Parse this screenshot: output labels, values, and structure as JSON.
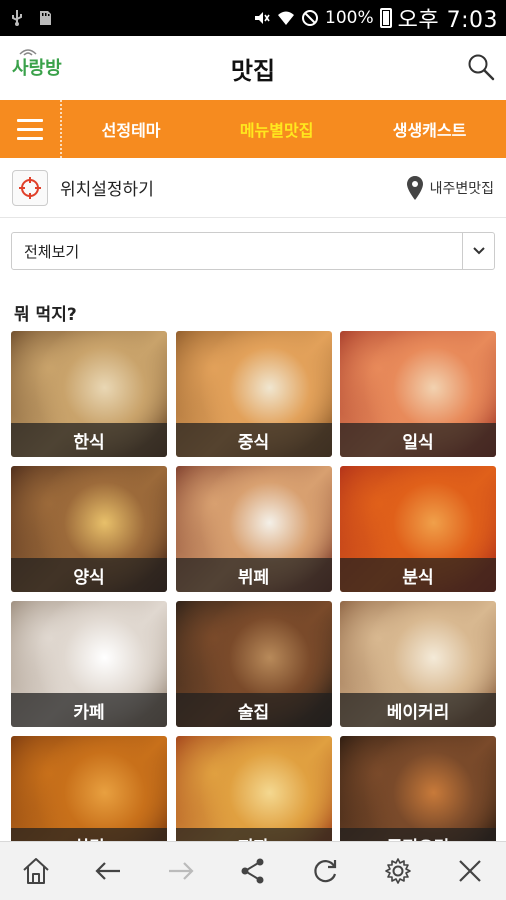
{
  "status_bar": {
    "battery": "100%",
    "time": "오후 7:03",
    "icons": [
      "usb-icon",
      "sd-card-icon",
      "mute-icon",
      "wifi-icon",
      "no-disturb-icon",
      "battery-icon"
    ]
  },
  "header": {
    "logo": "사랑방",
    "title": "맛집",
    "search_icon": "search-icon"
  },
  "nav": {
    "menu_icon": "hamburger-icon",
    "tabs": [
      {
        "label": "선정테마",
        "active": false
      },
      {
        "label": "메뉴별맛집",
        "active": true
      },
      {
        "label": "생생캐스트",
        "active": false
      }
    ]
  },
  "location": {
    "label": "위치설정하기",
    "nearby": "내주변맛집"
  },
  "filter": {
    "selected": "전체보기"
  },
  "section_title": "뭐 먹지?",
  "categories": [
    {
      "label": "한식",
      "colors": [
        "#6b4a2a",
        "#c9a36b",
        "#e9d7b4"
      ]
    },
    {
      "label": "중식",
      "colors": [
        "#8c5a2a",
        "#e2a15a",
        "#f0e6d0"
      ]
    },
    {
      "label": "일식",
      "colors": [
        "#a53a2a",
        "#e88a5a",
        "#f2d2b0"
      ]
    },
    {
      "label": "양식",
      "colors": [
        "#4a2a1a",
        "#9c6a3a",
        "#e8c06a"
      ]
    },
    {
      "label": "뷔페",
      "colors": [
        "#7a3a2a",
        "#d8a070",
        "#f4f0e8"
      ]
    },
    {
      "label": "분식",
      "colors": [
        "#b0301a",
        "#e0601a",
        "#f0a04a"
      ]
    },
    {
      "label": "카페",
      "colors": [
        "#9a8a7a",
        "#e0d8d0",
        "#ffffff"
      ]
    },
    {
      "label": "술집",
      "colors": [
        "#2a2018",
        "#7a4a2a",
        "#b88a5a"
      ]
    },
    {
      "label": "베이커리",
      "colors": [
        "#8a6040",
        "#d8b890",
        "#f4ead8"
      ]
    },
    {
      "label": "치킨",
      "colors": [
        "#7a3a10",
        "#c8701a",
        "#e8a040"
      ]
    },
    {
      "label": "피자",
      "colors": [
        "#a0401a",
        "#e0a040",
        "#f4d890"
      ]
    },
    {
      "label": "퓨전요리",
      "colors": [
        "#2a1a10",
        "#7a4a2a",
        "#c87a3a"
      ]
    }
  ],
  "toolbar": [
    "home-icon",
    "back-arrow-icon",
    "forward-arrow-icon",
    "share-icon",
    "refresh-icon",
    "settings-icon",
    "close-icon"
  ],
  "colors": {
    "accent": "#f68b1f",
    "active_tab": "#ffe81e"
  }
}
